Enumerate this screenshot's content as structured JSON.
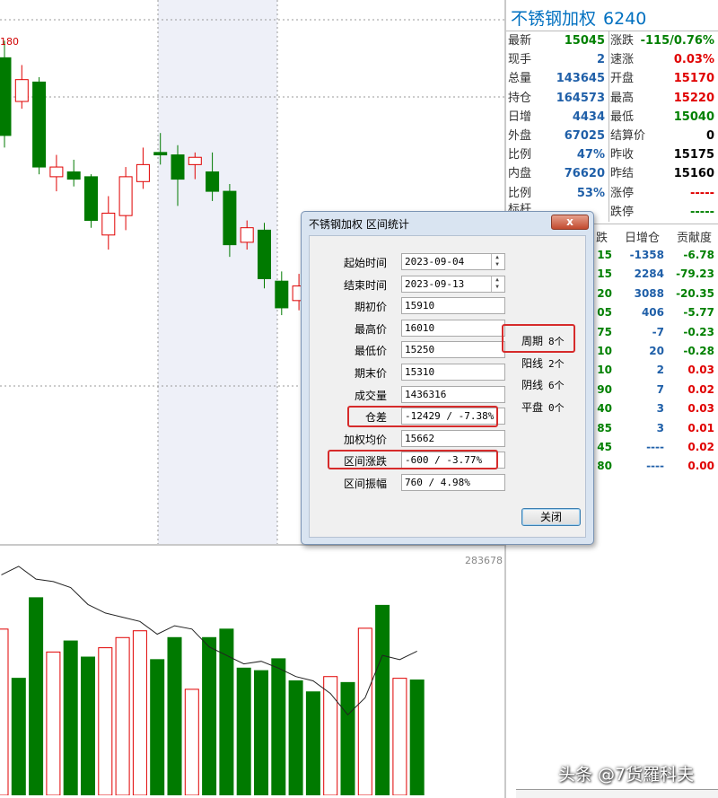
{
  "chart": {
    "price_label": "180",
    "max_volume_label": "283678",
    "candles": [
      {
        "o": 15330,
        "c": 15010,
        "h": 15400,
        "l": 14960,
        "up": false
      },
      {
        "o": 15150,
        "c": 15240,
        "h": 15300,
        "l": 15120,
        "up": true
      },
      {
        "o": 15230,
        "c": 14880,
        "h": 15250,
        "l": 14850,
        "up": false
      },
      {
        "o": 14880,
        "c": 14840,
        "h": 14930,
        "l": 14780,
        "up": true
      },
      {
        "o": 14860,
        "c": 14830,
        "h": 14910,
        "l": 14800,
        "up": false
      },
      {
        "o": 14840,
        "c": 14660,
        "h": 14850,
        "l": 14630,
        "up": false
      },
      {
        "o": 14600,
        "c": 14690,
        "h": 14760,
        "l": 14540,
        "up": true
      },
      {
        "o": 14680,
        "c": 14840,
        "h": 14880,
        "l": 14620,
        "up": true
      },
      {
        "o": 14820,
        "c": 14890,
        "h": 14960,
        "l": 14790,
        "up": true
      },
      {
        "o": 14940,
        "c": 14930,
        "h": 15020,
        "l": 14890,
        "up": false
      },
      {
        "o": 14930,
        "c": 14830,
        "h": 14970,
        "l": 14720,
        "up": false
      },
      {
        "o": 14890,
        "c": 14920,
        "h": 14940,
        "l": 14830,
        "up": true
      },
      {
        "o": 14860,
        "c": 14780,
        "h": 14940,
        "l": 14740,
        "up": false
      },
      {
        "o": 14780,
        "c": 14560,
        "h": 14810,
        "l": 14510,
        "up": false
      },
      {
        "o": 14570,
        "c": 14630,
        "h": 14660,
        "l": 14540,
        "up": true
      },
      {
        "o": 14620,
        "c": 14420,
        "h": 14650,
        "l": 14380,
        "up": false
      },
      {
        "o": 14410,
        "c": 14300,
        "h": 14450,
        "l": 14270,
        "up": false
      },
      {
        "o": 14330,
        "c": 14390,
        "h": 14440,
        "l": 14290,
        "up": true
      }
    ],
    "volumes": [
      {
        "v": 196000,
        "up": true
      },
      {
        "v": 138000,
        "up": false
      },
      {
        "v": 233000,
        "up": false
      },
      {
        "v": 169000,
        "up": true
      },
      {
        "v": 182000,
        "up": false
      },
      {
        "v": 163000,
        "up": false
      },
      {
        "v": 174000,
        "up": true
      },
      {
        "v": 186000,
        "up": true
      },
      {
        "v": 194000,
        "up": true
      },
      {
        "v": 160000,
        "up": false
      },
      {
        "v": 186000,
        "up": false
      },
      {
        "v": 125000,
        "up": true
      },
      {
        "v": 186000,
        "up": false
      },
      {
        "v": 196000,
        "up": false
      },
      {
        "v": 150000,
        "up": false
      },
      {
        "v": 147000,
        "up": false
      },
      {
        "v": 161000,
        "up": false
      },
      {
        "v": 135000,
        "up": false
      },
      {
        "v": 122000,
        "up": false
      },
      {
        "v": 140000,
        "up": true
      },
      {
        "v": 133000,
        "up": false
      },
      {
        "v": 197000,
        "up": true
      },
      {
        "v": 224000,
        "up": false
      },
      {
        "v": 138000,
        "up": true
      },
      {
        "v": 136000,
        "up": false
      }
    ],
    "oi_line": [
      260000,
      270000,
      255000,
      252000,
      245000,
      225000,
      215000,
      210000,
      205000,
      190000,
      200000,
      196000,
      175000,
      165000,
      155000,
      158000,
      150000,
      140000,
      135000,
      120000,
      95000,
      115000,
      165000,
      160000,
      170000
    ]
  },
  "quote": {
    "name": "不锈钢加权",
    "code": "6240",
    "left_rows": [
      {
        "label": "最新",
        "value": "15045",
        "color": "green"
      },
      {
        "label": "现手",
        "value": "2",
        "color": "blue"
      },
      {
        "label": "总量",
        "value": "143645",
        "color": "blue"
      },
      {
        "label": "持仓",
        "value": "164573",
        "color": "blue"
      },
      {
        "label": "日增",
        "value": "4434",
        "color": "blue"
      },
      {
        "label": "外盘",
        "value": "67025",
        "color": "blue"
      },
      {
        "label": "比例",
        "value": "47%",
        "color": "blue"
      },
      {
        "label": "内盘",
        "value": "76620",
        "color": "blue"
      },
      {
        "label": "比例",
        "value": "53%",
        "color": "blue"
      }
    ],
    "right_rows": [
      {
        "label": "涨跌",
        "value": "-115/0.76%",
        "color": "green"
      },
      {
        "label": "速涨",
        "value": "0.03%",
        "color": "red"
      },
      {
        "label": "开盘",
        "value": "15170",
        "color": "red"
      },
      {
        "label": "最高",
        "value": "15220",
        "color": "red"
      },
      {
        "label": "最低",
        "value": "15040",
        "color": "green"
      },
      {
        "label": "结算价",
        "value": "0",
        "color": "black"
      },
      {
        "label": "昨收",
        "value": "15175",
        "color": "black"
      },
      {
        "label": "昨结",
        "value": "15160",
        "color": "black"
      },
      {
        "label": "涨停",
        "value": "-----",
        "color": "red"
      },
      {
        "label": "跌停",
        "value": "-----",
        "color": "green"
      }
    ],
    "partial_row": "标杆",
    "table_headers": [
      "跌",
      "日增仓",
      "贡献度"
    ],
    "table_rows": [
      [
        "15",
        "-1358",
        "-6.78"
      ],
      [
        "15",
        "2284",
        "-79.23"
      ],
      [
        "20",
        "3088",
        "-20.35"
      ],
      [
        "05",
        "406",
        "-5.77"
      ],
      [
        "75",
        "-7",
        "-0.23"
      ],
      [
        "10",
        "20",
        "-0.28"
      ],
      [
        "10",
        "2",
        "0.03"
      ],
      [
        "90",
        "7",
        "0.02"
      ],
      [
        "40",
        "3",
        "0.03"
      ],
      [
        "85",
        "3",
        "0.01"
      ],
      [
        "45",
        "----",
        "0.02"
      ],
      [
        "80",
        "----",
        "0.00"
      ]
    ]
  },
  "dialog": {
    "title": "不锈钢加权 区间统计",
    "close_x": "x",
    "fields": [
      {
        "label": "起始时间",
        "value": "2023-09-04"
      },
      {
        "label": "结束时间",
        "value": "2023-09-13"
      },
      {
        "label": "期初价",
        "value": "15910"
      },
      {
        "label": "最高价",
        "value": "16010"
      },
      {
        "label": "最低价",
        "value": "15250"
      },
      {
        "label": "期末价",
        "value": "15310"
      },
      {
        "label": "成交量",
        "value": "1436316"
      },
      {
        "label": "仓差",
        "value": "-12429 / -7.38%"
      },
      {
        "label": "加权均价",
        "value": "15662"
      },
      {
        "label": "区间涨跌",
        "value": "-600 / -3.77%"
      },
      {
        "label": "区间振幅",
        "value": "760 / 4.98%"
      }
    ],
    "stats": [
      {
        "label": "周期",
        "value": "8个"
      },
      {
        "label": "阳线",
        "value": "2个"
      },
      {
        "label": "阴线",
        "value": "6个"
      },
      {
        "label": "平盘",
        "value": "0个"
      }
    ],
    "close_button": "关闭"
  },
  "watermark": "头条 @7货羅科夫",
  "colors": {
    "up": "#e00000",
    "down": "#007a00",
    "grid": "#9a9a9a",
    "highlight": "#d62b2b"
  }
}
